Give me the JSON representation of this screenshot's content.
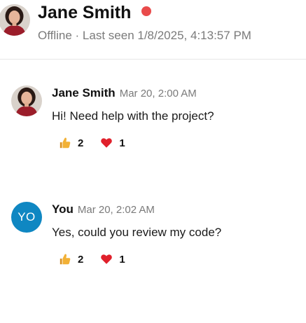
{
  "header": {
    "name": "Jane Smith",
    "status_text": "Offline · Last seen 1/8/2025, 4:13:57 PM",
    "status_color": "#e94b4b",
    "avatar_icon": "user-photo-icon"
  },
  "messages": [
    {
      "author": "Jane Smith",
      "time": "Mar 20, 2:00 AM",
      "text": "Hi! Need help with the project?",
      "avatar": "user-photo-icon",
      "reactions": [
        {
          "icon": "thumbs-up-icon",
          "count": "2"
        },
        {
          "icon": "heart-icon",
          "count": "1"
        }
      ]
    },
    {
      "author": "You",
      "time": "Mar 20, 2:02 AM",
      "text": "Yes, could you review my code?",
      "avatar_initials": "YO",
      "avatar_color": "#0f87c2",
      "reactions": [
        {
          "icon": "thumbs-up-icon",
          "count": "2"
        },
        {
          "icon": "heart-icon",
          "count": "1"
        }
      ]
    }
  ],
  "colors": {
    "reaction_thumb": "#f2b136",
    "reaction_heart": "#e0202b",
    "muted_text": "#7a7a7a"
  }
}
